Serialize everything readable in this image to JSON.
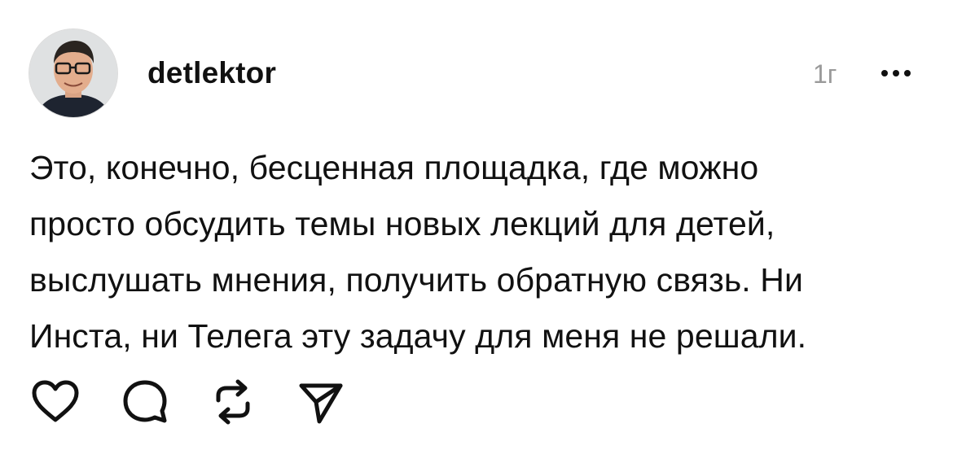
{
  "post": {
    "username": "detlektor",
    "time": "1г",
    "text_lines": [
      "Это, конечно, бесценная площадка, где можно",
      "просто обсудить темы новых лекций для детей,",
      "выслушать мнения, получить обратную связь. Ни",
      "Инста, ни Телега эту задачу для меня не решали."
    ]
  },
  "header": {
    "more_icon": "more-horizontal-icon"
  },
  "actions": [
    {
      "name": "like",
      "icon": "heart-icon"
    },
    {
      "name": "comment",
      "icon": "comment-bubble-icon"
    },
    {
      "name": "repost",
      "icon": "repost-arrows-icon"
    },
    {
      "name": "share",
      "icon": "send-icon"
    }
  ],
  "colors": {
    "text": "#111111",
    "secondary": "#9a9a9a",
    "background": "#ffffff"
  }
}
